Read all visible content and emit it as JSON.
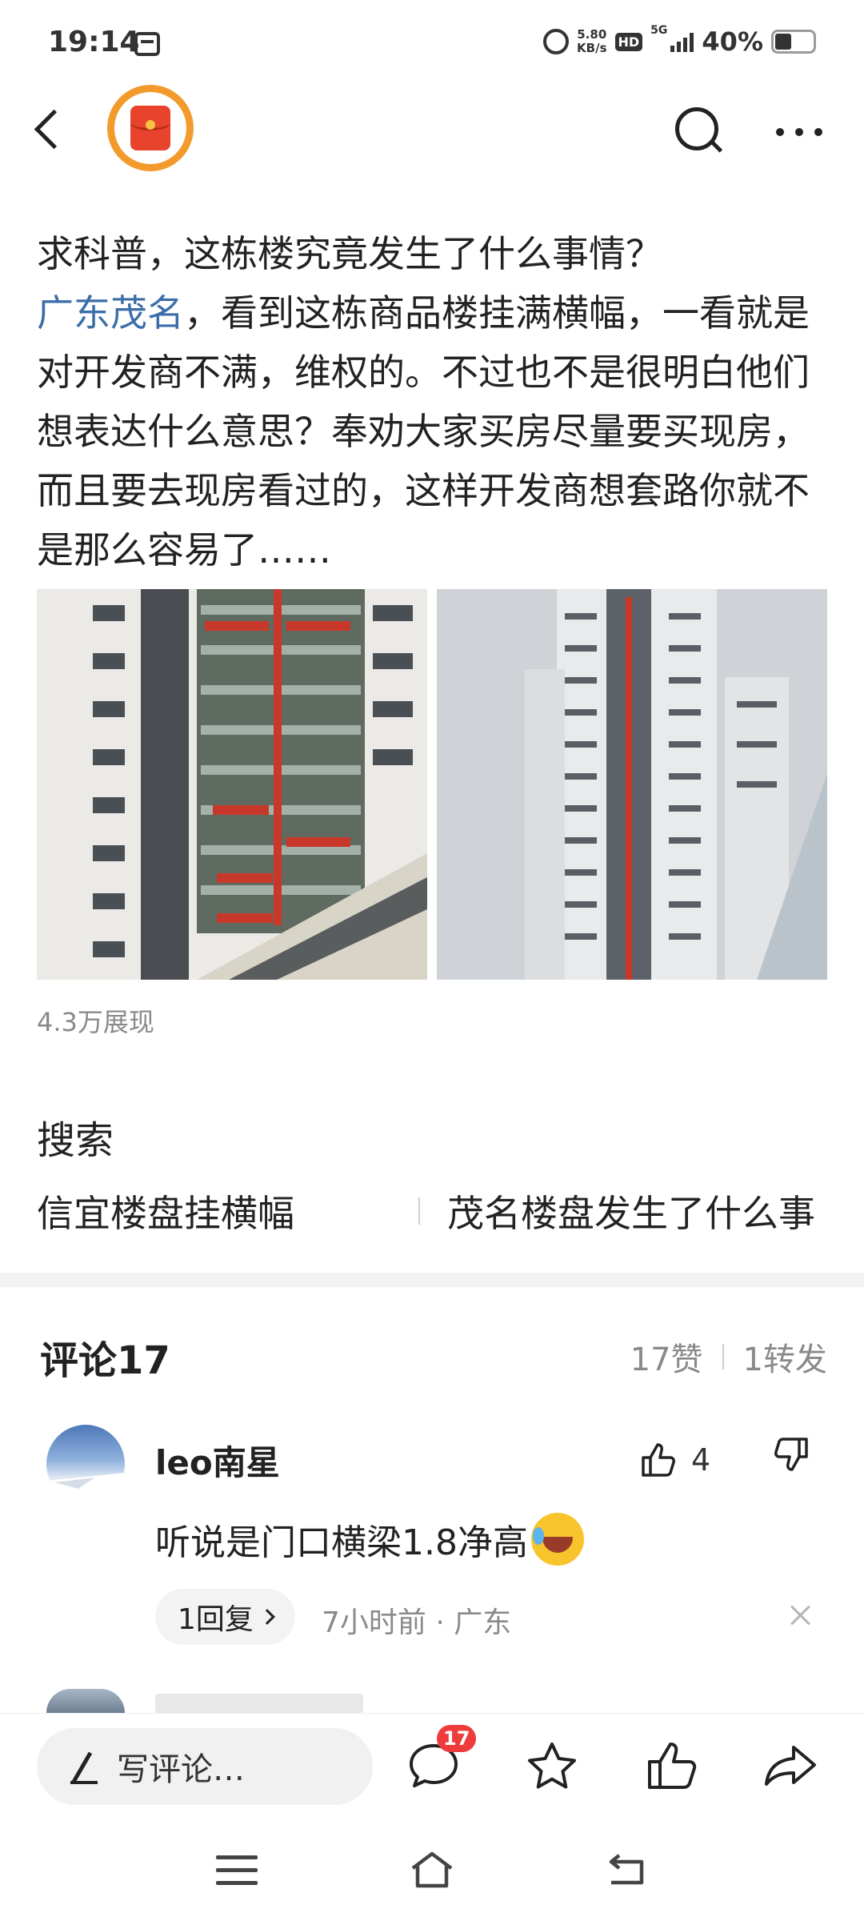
{
  "status_bar": {
    "time": "19:14",
    "net_speed_value": "5.80",
    "net_speed_unit": "KB/s",
    "hd": "HD",
    "network": "5G",
    "battery": "40%"
  },
  "header": {
    "logo_icon": "red-packet-icon",
    "back_icon": "chevron-left-icon",
    "search_icon": "search-icon",
    "more_icon": "more-dots-icon"
  },
  "post": {
    "line1": "求科普，这栋楼究竟发生了什么事情？",
    "link": "广东茂名",
    "body": "，看到这栋商品楼挂满横幅，一看就是对开发商不满，维权的。不过也不是很明白他们想表达什么意思？奉劝大家买房尽量要买现房，而且要去现房看过的，这样开发商想套路你就不是那么容易了……",
    "views": "4.3万展现"
  },
  "search": {
    "title": "搜索",
    "suggestions": [
      "信宜楼盘挂横幅",
      "茂名楼盘发生了什么事"
    ]
  },
  "comments": {
    "title": "评论17",
    "likes": "17赞",
    "shares": "1转发",
    "items": [
      {
        "user": "leo南星",
        "like_count": "4",
        "text": "听说是门口横梁1.8净高",
        "emoji": "laughing-tears-emoji",
        "reply_label": "1回复",
        "meta": "7小时前 · 广东"
      }
    ]
  },
  "action_bar": {
    "write_placeholder": "写评论…",
    "comment_badge": "17",
    "icons": [
      "comment-icon",
      "star-icon",
      "thumbs-up-icon",
      "share-icon"
    ]
  },
  "nav_bar": {
    "icons": [
      "menu-icon",
      "home-icon",
      "back-icon"
    ]
  },
  "colors": {
    "link": "#3b6ea8",
    "badge": "#ee3b3b",
    "logo_ring": "#f39a2c",
    "red_packet": "#e8432c"
  }
}
